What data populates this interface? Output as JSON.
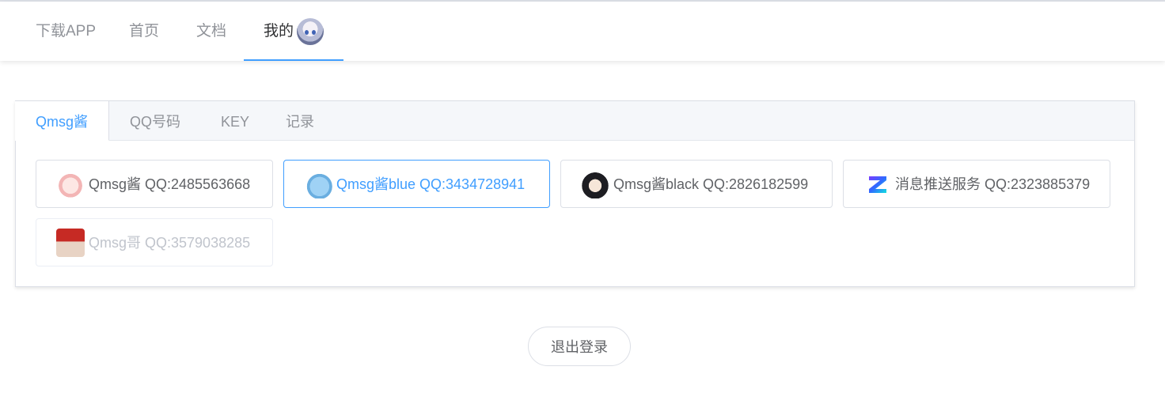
{
  "nav": {
    "items": [
      {
        "label": "下载APP"
      },
      {
        "label": "首页"
      },
      {
        "label": "文档"
      },
      {
        "label": "我的"
      }
    ],
    "active": "我的"
  },
  "tabs": [
    {
      "label": "Qmsg酱"
    },
    {
      "label": "QQ号码"
    },
    {
      "label": "KEY"
    },
    {
      "label": "记录"
    }
  ],
  "active_tab": "Qmsg酱",
  "bots": [
    {
      "label": "Qmsg酱 QQ:2485563668",
      "icon": "anime-girl-pink-avatar-icon"
    },
    {
      "label": "Qmsg酱blue QQ:3434728941",
      "icon": "anime-girl-blue-avatar-icon",
      "selected": true
    },
    {
      "label": "Qmsg酱black QQ:2826182599",
      "icon": "anime-girl-black-avatar-icon"
    },
    {
      "label": "消息推送服务 QQ:2323885379",
      "icon": "z-logo-icon"
    },
    {
      "label": "Qmsg哥 QQ:3579038285",
      "icon": "red-hat-avatar-icon",
      "disabled": true
    }
  ],
  "logout_label": "退出登录",
  "colors": {
    "accent": "#409eff",
    "muted": "#909399",
    "disabled": "#c0c4cc"
  }
}
